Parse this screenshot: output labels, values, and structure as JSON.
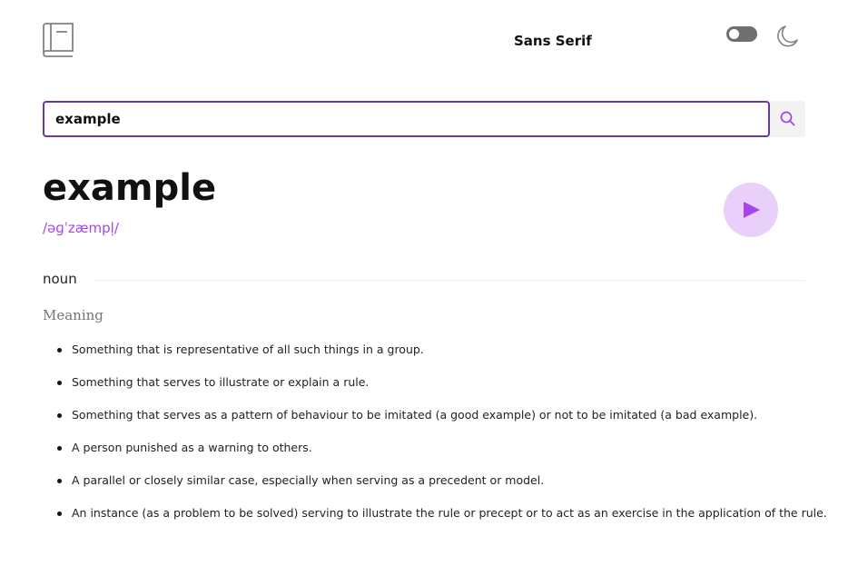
{
  "header": {
    "logo_icon": "book-icon",
    "font_selector_label": "Sans Serif",
    "theme_toggle_icon": "toggle-switch-icon",
    "dark_mode_icon": "moon-icon"
  },
  "search": {
    "value": "example",
    "button_icon": "search-icon",
    "accent_color": "#6b3a99"
  },
  "entry": {
    "word": "example",
    "phonetic": "/əɡˈzæmpl̩/",
    "play_icon": "play-icon",
    "accent_color": "#a445ed"
  },
  "meanings": [
    {
      "part_of_speech": "noun",
      "label": "Meaning",
      "definitions": [
        "Something that is representative of all such things in a group.",
        "Something that serves to illustrate or explain a rule.",
        "Something that serves as a pattern of behaviour to be imitated (a good example) or not to be imitated (a bad example).",
        "A person punished as a warning to others.",
        "A parallel or closely similar case, especially when serving as a precedent or model.",
        "An instance (as a problem to be solved) serving to illustrate the rule or precept or to act as an exercise in the application of the rule."
      ]
    }
  ]
}
